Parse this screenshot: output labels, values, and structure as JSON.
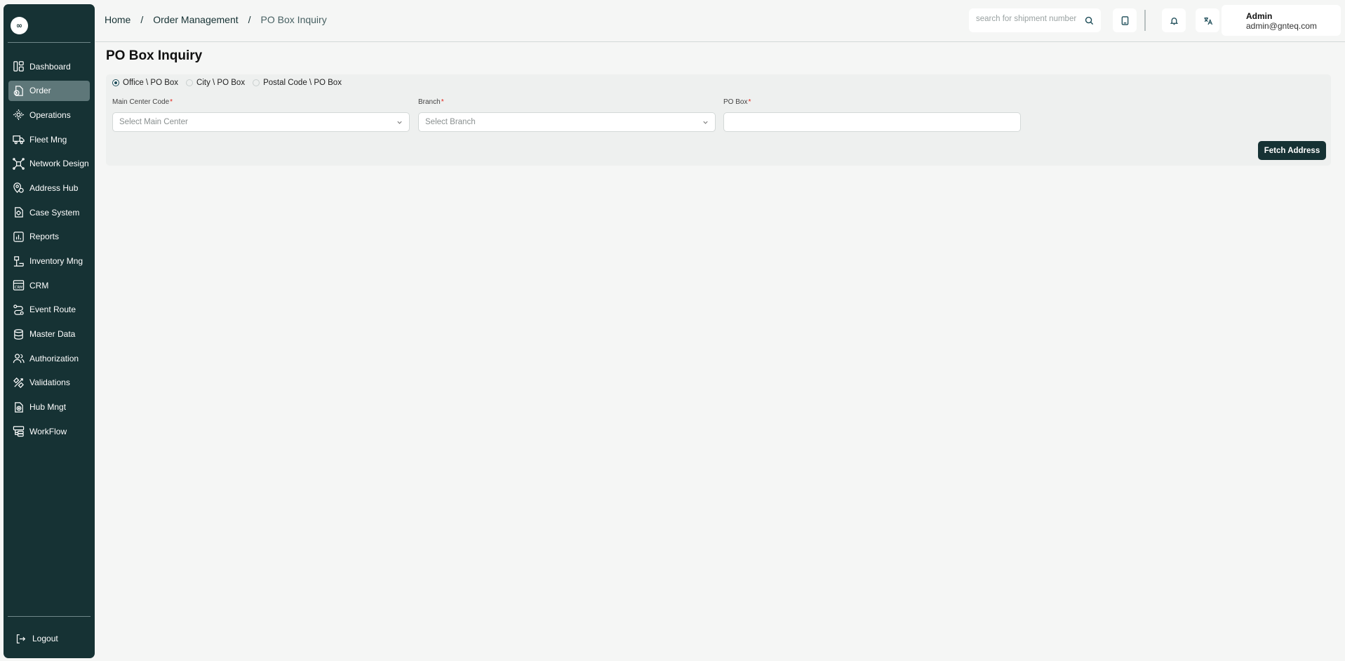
{
  "sidebar": {
    "logo_text": "∞",
    "items": [
      {
        "label": "Dashboard",
        "icon": "dashboard-icon",
        "active": false
      },
      {
        "label": "Order",
        "icon": "order-icon",
        "active": true
      },
      {
        "label": "Operations",
        "icon": "operations-icon",
        "active": false
      },
      {
        "label": "Fleet Mng",
        "icon": "truck-icon",
        "active": false
      },
      {
        "label": "Network Design",
        "icon": "network-icon",
        "active": false
      },
      {
        "label": "Address Hub",
        "icon": "address-icon",
        "active": false
      },
      {
        "label": "Case System",
        "icon": "case-icon",
        "active": false
      },
      {
        "label": "Reports",
        "icon": "reports-icon",
        "active": false
      },
      {
        "label": "Inventory Mng",
        "icon": "inventory-icon",
        "active": false
      },
      {
        "label": "CRM",
        "icon": "crm-icon",
        "active": false
      },
      {
        "label": "Event Route",
        "icon": "route-icon",
        "active": false
      },
      {
        "label": "Master Data",
        "icon": "database-icon",
        "active": false
      },
      {
        "label": "Authorization",
        "icon": "users-icon",
        "active": false
      },
      {
        "label": "Validations",
        "icon": "validations-icon",
        "active": false
      },
      {
        "label": "Hub Mngt",
        "icon": "hub-icon",
        "active": false
      },
      {
        "label": "WorkFlow",
        "icon": "workflow-icon",
        "active": false
      }
    ],
    "logout_label": "Logout"
  },
  "header": {
    "breadcrumb": [
      "Home",
      "Order Management",
      "PO Box Inquiry"
    ],
    "search_placeholder": "search for shipment number",
    "user_name": "Admin",
    "user_email": "admin@gnteq.com"
  },
  "main": {
    "title": "PO Box Inquiry",
    "radio_options": [
      {
        "label": "Office \\ PO Box",
        "selected": true
      },
      {
        "label": "City \\ PO Box",
        "selected": false
      },
      {
        "label": "Postal Code \\ PO Box",
        "selected": false
      }
    ],
    "fields": {
      "main_center": {
        "label": "Main Center Code",
        "placeholder": "Select Main Center",
        "required_mark": "*"
      },
      "branch": {
        "label": "Branch",
        "placeholder": "Select Branch",
        "required_mark": "*"
      },
      "po_box": {
        "label": "PO Box",
        "value": "",
        "required_mark": "*"
      }
    },
    "fetch_label": "Fetch Address"
  },
  "colors": {
    "sidebar_bg": "#163234",
    "active_item": "#5e7779",
    "accent": "#163234",
    "required": "#e2231a"
  }
}
